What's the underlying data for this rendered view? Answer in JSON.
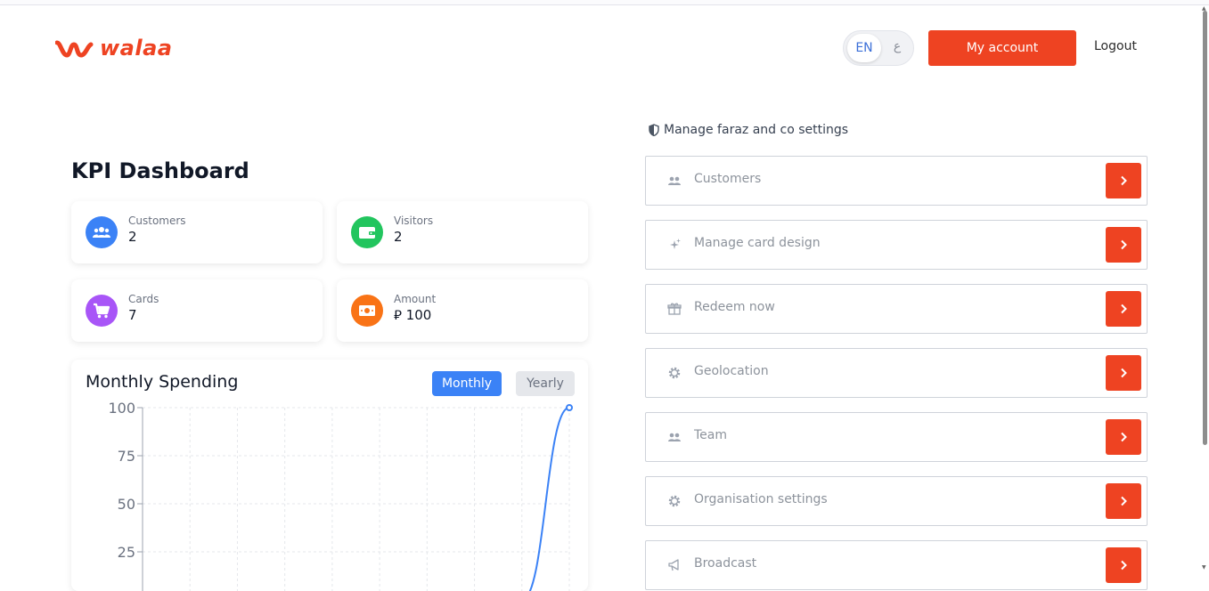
{
  "brand": {
    "name": "walaa",
    "color": "#ee4322"
  },
  "header": {
    "lang_en": "EN",
    "lang_ar": "ع",
    "my_account": "My account",
    "logout": "Logout"
  },
  "dashboard": {
    "title": "KPI Dashboard",
    "kpis": [
      {
        "label": "Customers",
        "value": "2",
        "icon": "users-icon",
        "color": "#3b82f6"
      },
      {
        "label": "Visitors",
        "value": "2",
        "icon": "wallet-icon",
        "color": "#22c55e"
      },
      {
        "label": "Cards",
        "value": "7",
        "icon": "cart-icon",
        "color": "#a855f7"
      },
      {
        "label": "Amount",
        "value": "⃁ 100",
        "icon": "money-icon",
        "color": "#f97316"
      }
    ]
  },
  "spending": {
    "title": "Monthly Spending",
    "monthly_label": "Monthly",
    "yearly_label": "Yearly",
    "active": "Monthly"
  },
  "chart_data": {
    "type": "line",
    "title": "Monthly Spending",
    "y_ticks": [
      "100",
      "75",
      "50",
      "25"
    ],
    "ylim": [
      0,
      100
    ],
    "series": [
      {
        "values": [
          0,
          0,
          0,
          0,
          0,
          0,
          0,
          0,
          0,
          100
        ]
      }
    ],
    "color": "#3b82f6",
    "grid": true
  },
  "settings": {
    "heading": "Manage faraz and co settings",
    "items": [
      {
        "label": "Customers",
        "icon": "users-icon"
      },
      {
        "label": "Manage card design",
        "icon": "sparkles-icon"
      },
      {
        "label": "Redeem now",
        "icon": "gift-icon"
      },
      {
        "label": "Geolocation",
        "icon": "gear-icon"
      },
      {
        "label": "Team",
        "icon": "users-icon"
      },
      {
        "label": "Organisation settings",
        "icon": "gear-icon"
      },
      {
        "label": "Broadcast",
        "icon": "megaphone-icon"
      }
    ]
  }
}
